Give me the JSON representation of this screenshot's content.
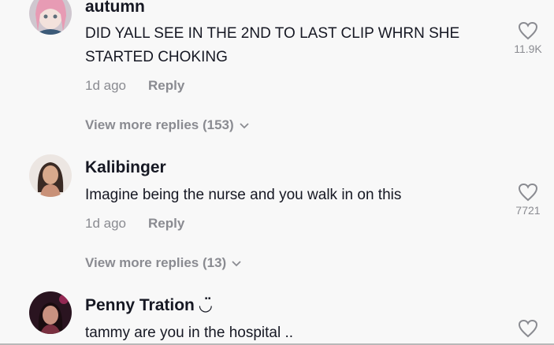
{
  "comments": [
    {
      "username": "autumn",
      "text": "DID YALL SEE IN THE 2ND TO LAST CLIP WHRN SHE STARTED CHOKING",
      "time": "1d ago",
      "reply_label": "Reply",
      "likes": "11.9K",
      "view_more": "View more replies (153)",
      "avatar_icon": "user-avatar-autumn"
    },
    {
      "username": "Kalibinger",
      "text": "Imagine being the nurse and you walk in on this",
      "time": "1d ago",
      "reply_label": "Reply",
      "likes": "7721",
      "view_more": "View more replies (13)",
      "avatar_icon": "user-avatar-kalibinger"
    },
    {
      "username": "Penny Tration ◡̈",
      "text": "tammy are you in the hospital ..",
      "avatar_icon": "user-avatar-penny"
    }
  ],
  "colors": {
    "background": "#f8f8f8",
    "primary_text": "#161823",
    "secondary_text": "#8a8b91"
  }
}
